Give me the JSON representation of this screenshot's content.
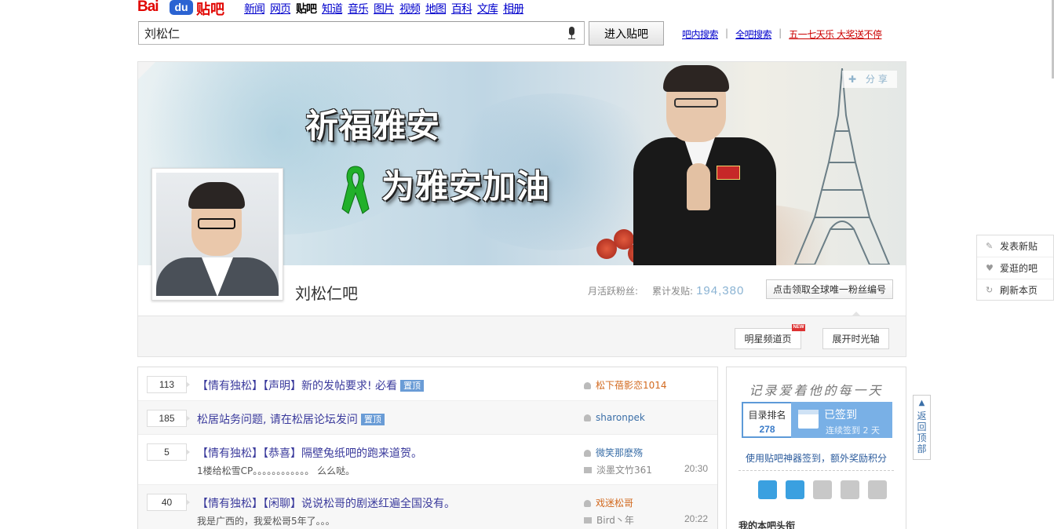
{
  "top": {
    "logo_bai": "Bai",
    "logo_du": "du",
    "logo_tieba": "贴吧",
    "nav": [
      "新闻",
      "网页",
      "贴吧",
      "知道",
      "音乐",
      "图片",
      "视频",
      "地图",
      "百科",
      "文库",
      "相册"
    ]
  },
  "search": {
    "value": "刘松仁",
    "enter_button": "进入贴吧",
    "link_inbar": "吧内搜索",
    "link_all": "全吧搜索",
    "link_promo": "五一七天乐 大奖送不停"
  },
  "banner": {
    "slogan1": "祈福雅安",
    "slogan2": "为雅安加油",
    "share": "分享"
  },
  "forum": {
    "name": "刘松仁吧",
    "fans_label": "月活跃粉丝:",
    "posts_label": "累计发贴:",
    "posts_value": "194,380",
    "fan_number_button": "点击领取全球唯一粉丝编号",
    "star_channel_button": "明星频道页",
    "new_tag": "NEW",
    "timeline_button": "展开时光轴"
  },
  "threads": [
    {
      "replies": "113",
      "title": "【情有独松】【声明】新的发帖要求! 必看",
      "tag": "置顶",
      "author": "松下蓓影恋1014",
      "abstract": "",
      "last_reply": "",
      "time": ""
    },
    {
      "replies": "185",
      "title": "松居站务问题, 请在松居论坛发问",
      "tag": "置顶",
      "author": "sharonpek",
      "abstract": "",
      "last_reply": "",
      "time": ""
    },
    {
      "replies": "5",
      "title": "【情有独松】【恭喜】隔壁兔纸吧的跑来道贺。",
      "tag": "",
      "author": "微笑那麽殇",
      "abstract": "1楼给松雪CP。。。。。。。。。。。。 么么哒。",
      "last_reply": "淡墨文竹361",
      "time": "20:30"
    },
    {
      "replies": "40",
      "title": "【情有独松】【闲聊】说说松哥的剧迷红遍全国没有。",
      "tag": "",
      "author": "戏迷松哥",
      "abstract": "我是广西的，我爱松哥5年了。。。",
      "last_reply": "Bird丶年",
      "time": "20:22"
    }
  ],
  "side": {
    "handwriting": "记录爱着他的每一天",
    "rank_label": "目录排名",
    "rank_value": "278",
    "signed_label": "已签到",
    "signed_sub": "连续签到 2 天",
    "tip": "使用贴吧神器签到，额外奖励积分",
    "my_head": "我的本吧头衔"
  },
  "float_menu": [
    "发表新贴",
    "爱逛的吧",
    "刷新本页"
  ],
  "backtop": [
    "返",
    "回",
    "顶",
    "部"
  ],
  "colors": {
    "brand_red": "#e10602",
    "brand_blue": "#2b63d2",
    "link": "#0000cc",
    "accent": "#79b0e6"
  }
}
